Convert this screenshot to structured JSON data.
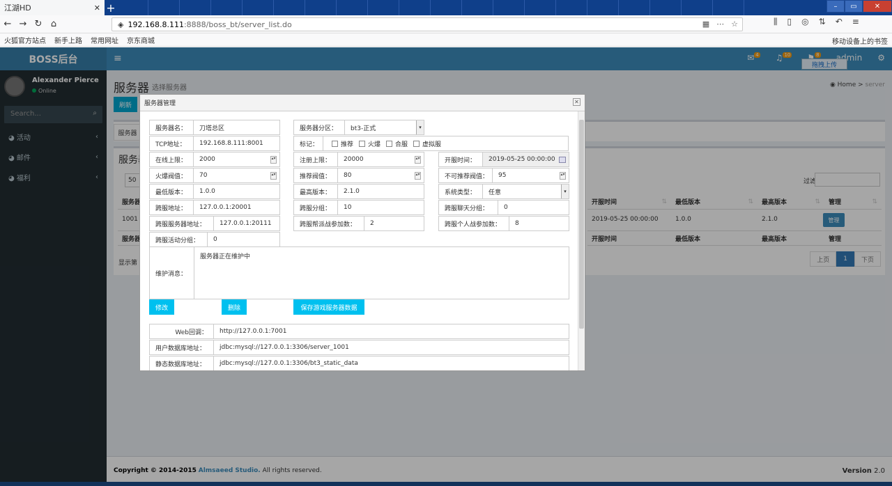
{
  "browser": {
    "active_tab": "江湖HD",
    "tab_close": "✕",
    "new_tab": "+",
    "url_host": "192.168.8.111",
    "url_rest": ":8888/boss_bt/server_list.do",
    "bookmarks": [
      "火狐官方站点",
      "新手上路",
      "常用网址",
      "京东商城"
    ],
    "mobile_bookmarks": "移动设备上的书签"
  },
  "app": {
    "logo": "BOSS后台",
    "hamburger": "≡",
    "user_menu": "admin",
    "badges": {
      "mail": "4",
      "bell": "10",
      "flag": "8"
    },
    "drag_upload": "拖拽上传"
  },
  "sidebar": {
    "user_name": "Alexander Pierce",
    "status": "Online",
    "search_placeholder": "Search...",
    "items": [
      {
        "label": "活动"
      },
      {
        "label": "邮件"
      },
      {
        "label": "福利"
      }
    ]
  },
  "page": {
    "title": "服务器",
    "subtitle": "选择服务器",
    "crumb_home": "Home",
    "crumb_current": "server",
    "refresh_button": "刷新",
    "box1_button": "服务器",
    "box2_title": "服务器",
    "page_length": "50",
    "filter_label": "过滤:",
    "table": {
      "headers_visible": [
        "服务器",
        "开服时间",
        "最低版本",
        "最高版本",
        "管理"
      ],
      "row": {
        "id": "1001",
        "open_time": "2019-05-25 00:00:00",
        "min_version": "1.0.0",
        "max_version": "2.1.0",
        "manage": "管理"
      },
      "footer_first": "服务器"
    },
    "info_text": "显示第",
    "pager": {
      "prev": "上页",
      "current": "1",
      "next": "下页"
    }
  },
  "footer": {
    "copyright_prefix": "Copyright © 2014-2015",
    "studio": "Almsaeed Studio.",
    "rights": "All rights reserved.",
    "version_label": "Version",
    "version": "2.0"
  },
  "modal": {
    "title": "服务器管理",
    "close": "✕",
    "fields": {
      "server_name": {
        "label": "服务器名：",
        "value": "刀塔总区"
      },
      "server_zone": {
        "label": "服务器分区：",
        "value": "bt3-正式"
      },
      "tcp": {
        "label": "TCP地址：",
        "value": "192.168.8.111:8001"
      },
      "marks": {
        "label": "标记：",
        "options": [
          "推荐",
          "火爆",
          "合服",
          "虚拟服"
        ]
      },
      "online_limit": {
        "label": "在线上限：",
        "value": "2000"
      },
      "register_limit": {
        "label": "注册上限：",
        "value": "20000"
      },
      "open_time": {
        "label": "开服时间：",
        "value": "2019-05-25 00:00:00"
      },
      "hot_threshold": {
        "label": "火爆阀值：",
        "value": "70"
      },
      "recommend_threshold": {
        "label": "推荐阀值：",
        "value": "80"
      },
      "no_recommend_threshold": {
        "label": "不可推荐阀值：",
        "value": "95"
      },
      "min_version": {
        "label": "最低版本：",
        "value": "1.0.0"
      },
      "max_version": {
        "label": "最高版本：",
        "value": "2.1.0"
      },
      "system_type": {
        "label": "系统类型：",
        "value": "任意"
      },
      "cross_addr": {
        "label": "跨服地址：",
        "value": "127.0.0.1:20001"
      },
      "cross_group": {
        "label": "跨服分组：",
        "value": "10"
      },
      "cross_chat_group": {
        "label": "跨服聊天分组：",
        "value": "0"
      },
      "cross_server_addr": {
        "label": "跨服服务器地址：",
        "value": "127.0.0.1:20111"
      },
      "cross_guild_count": {
        "label": "跨服帮派战参加数：",
        "value": "2"
      },
      "cross_personal_count": {
        "label": "跨服个人战参加数：",
        "value": "8"
      },
      "cross_activity_group": {
        "label": "跨服活动分组：",
        "value": "0"
      },
      "maintenance": {
        "label": "维护消息：",
        "value": "服务器正在维护中"
      },
      "web_callback": {
        "label": "Web回调：",
        "value": "http://127.0.0.1:7001"
      },
      "user_db": {
        "label": "用户数据库地址：",
        "value": "jdbc:mysql://127.0.0.1:3306/server_1001"
      },
      "static_db": {
        "label": "静态数据库地址：",
        "value": "jdbc:mysql://127.0.0.1:3306/bt3_static_data"
      }
    },
    "buttons": {
      "modify": "修改",
      "delete": "删除",
      "save": "保存游戏服务器数据"
    }
  }
}
